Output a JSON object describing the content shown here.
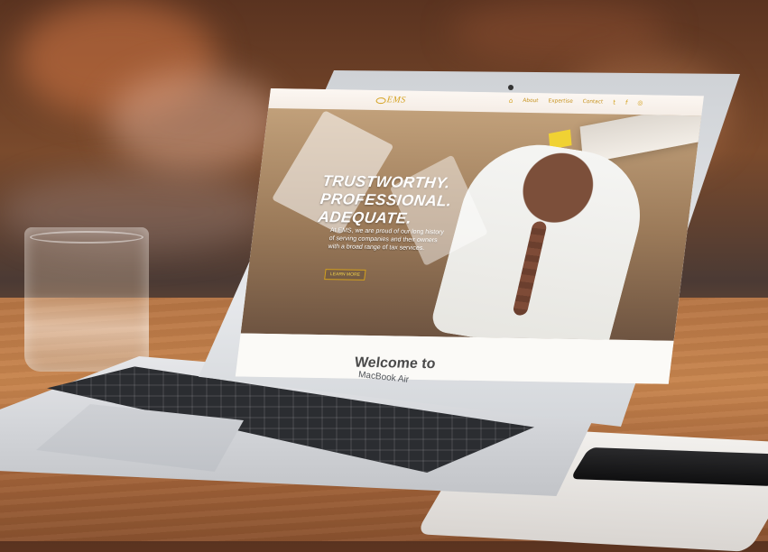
{
  "device": {
    "model": "MacBook Air"
  },
  "website": {
    "logo": "EMS",
    "nav": {
      "items": [
        "About",
        "Expertise",
        "Contact"
      ],
      "icons": {
        "home": "⌂",
        "twitter": "t",
        "facebook": "f",
        "instagram": "◎"
      }
    },
    "hero": {
      "title_lines": [
        "TRUSTWORTHY.",
        "PROFESSIONAL.",
        "ADEQUATE."
      ],
      "body": "At EMS, we are proud of our long history of serving companies and their owners with a broad range of tax services.",
      "button": "LEARN MORE"
    },
    "welcome": "Welcome to"
  },
  "colors": {
    "brand_gold": "#d4a11e",
    "page_bg": "#f6f4ef"
  }
}
